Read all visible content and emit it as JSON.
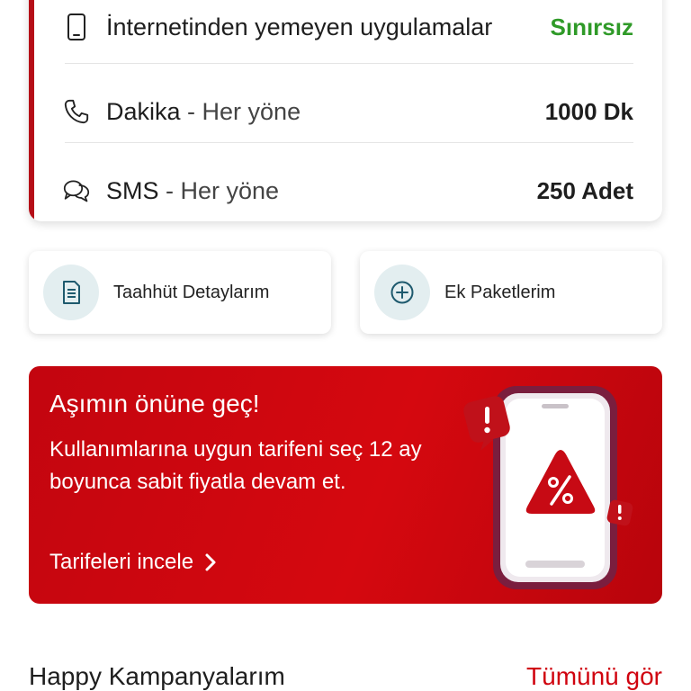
{
  "usage": {
    "rows": [
      {
        "icon": "phone-device-icon",
        "label": "İnternetinden yemeyen uygulamalar",
        "sub": "",
        "value": "Sınırsız"
      },
      {
        "icon": "phone-call-icon",
        "label": "Dakika",
        "sub": " - Her yöne",
        "value": "1000 Dk"
      },
      {
        "icon": "chat-bubbles-icon",
        "label": "SMS",
        "sub": " - Her yöne",
        "value": "250 Adet"
      }
    ]
  },
  "shortcuts": {
    "commitment": {
      "icon": "document-icon",
      "label": "Taahhüt Detaylarım"
    },
    "packages": {
      "icon": "plus-circle-icon",
      "label": "Ek Paketlerim"
    }
  },
  "promo": {
    "title": "Aşımın önüne geç!",
    "description": "Kullanımlarına uygun tarifeni seç 12 ay boyunca sabit fiyatla devam et.",
    "cta": "Tarifeleri incele",
    "art_text": "%"
  },
  "campaigns": {
    "title": "Happy Kampanyalarım",
    "see_all": "Tümünü gör"
  },
  "colors": {
    "accent": "#b50e17",
    "brand_red": "#d0030f",
    "success_green": "#2f9a28",
    "icon_bg": "#e3eef0"
  }
}
